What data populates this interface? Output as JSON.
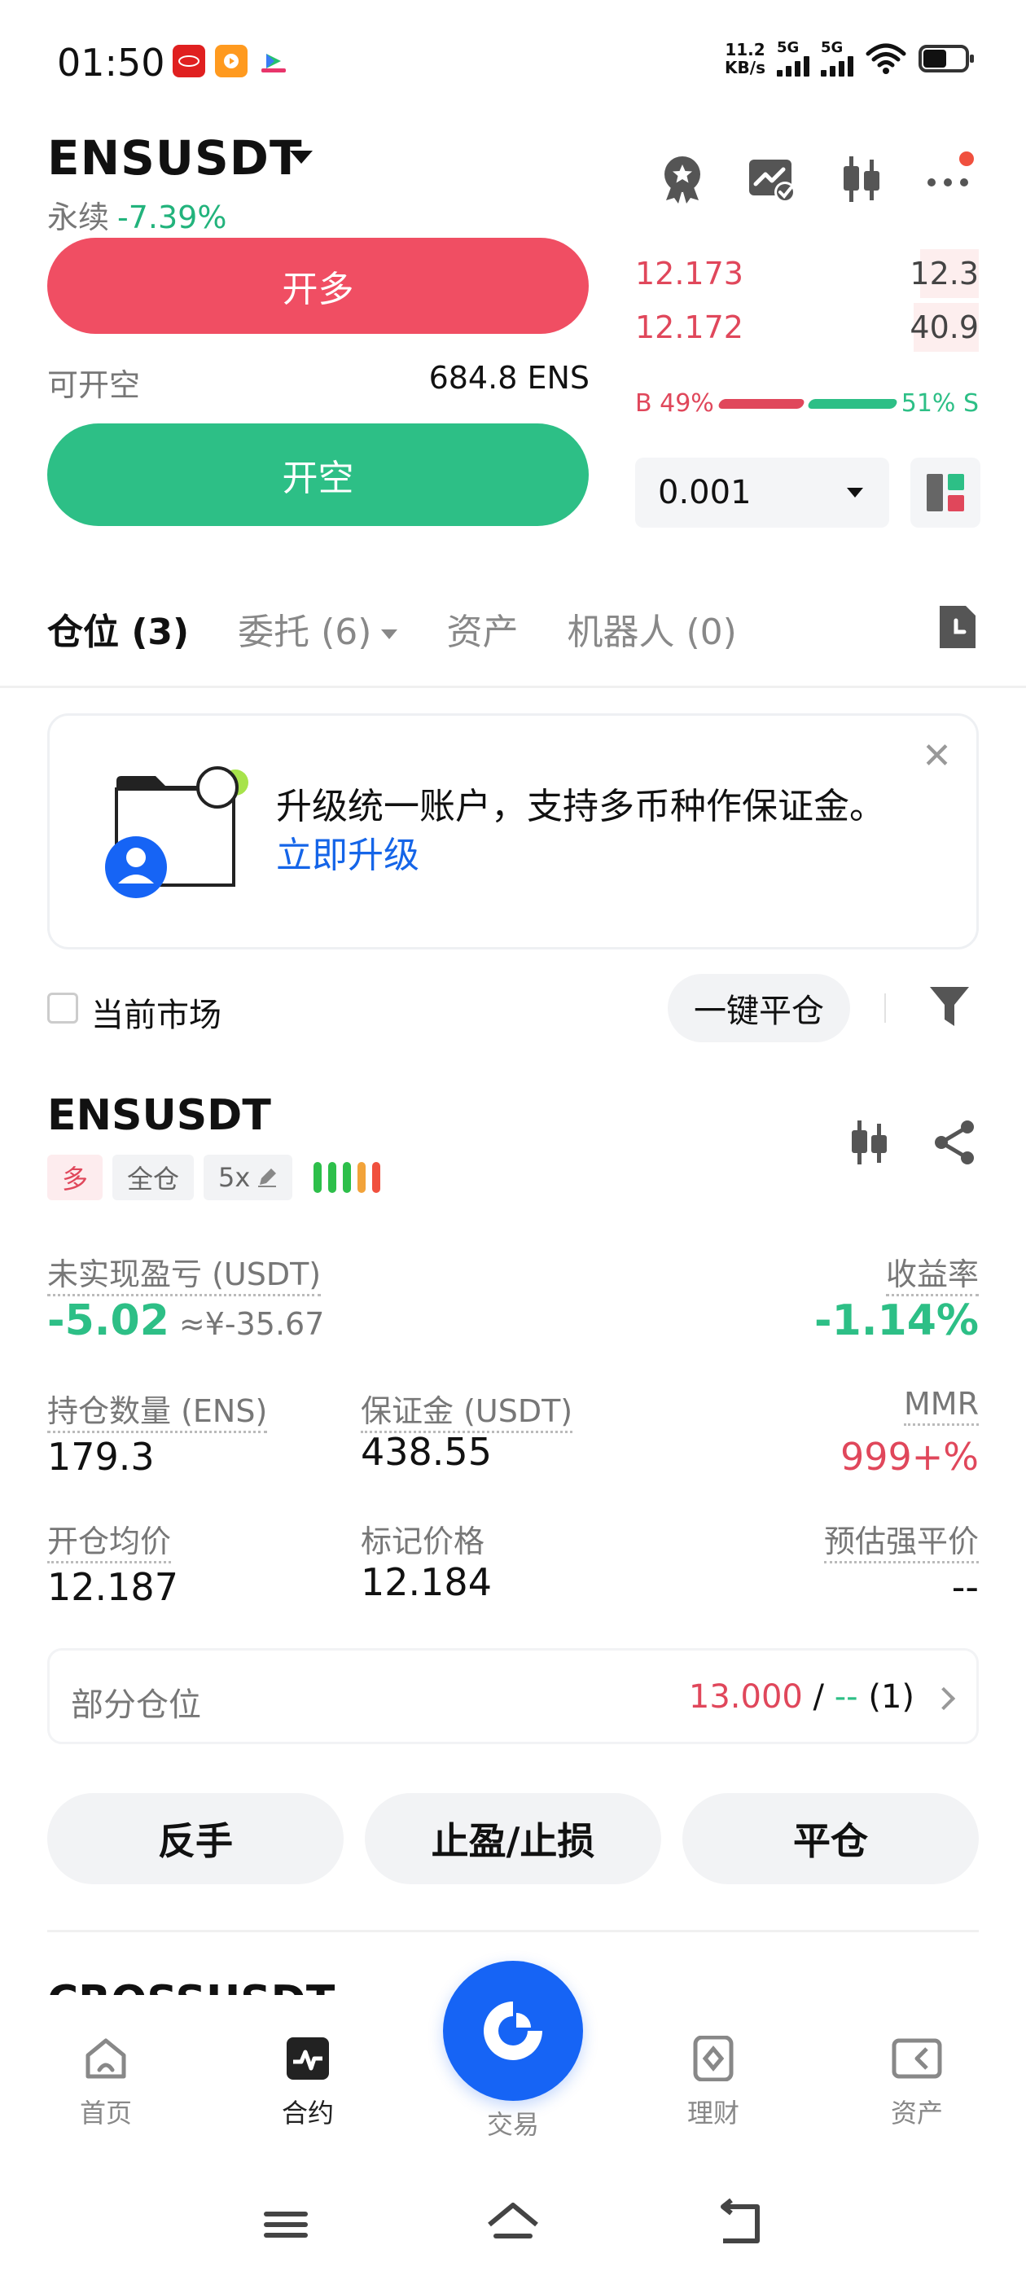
{
  "status_bar": {
    "time": "01:50",
    "net_speed": "11.2",
    "net_unit": "KB/s",
    "sig1": "5G",
    "sig2": "5G",
    "apps": [
      "byd-app-icon",
      "video-app-icon",
      "shop-app-icon"
    ]
  },
  "header": {
    "pair": "ENSUSDT",
    "market_type": "永续",
    "change": "-7.39%",
    "icons": [
      "award-icon",
      "chart-edit-icon",
      "candlestick-icon",
      "more-icon"
    ],
    "has_notification": true
  },
  "order_panel": {
    "long_label": "开多",
    "available_label": "可开空",
    "available_value": "684.8 ENS",
    "short_label": "开空"
  },
  "order_book": {
    "asks": [
      {
        "price": "12.173",
        "qty": "12.3",
        "depth": 0.17
      },
      {
        "price": "12.172",
        "qty": "40.9",
        "depth": 0.19
      }
    ],
    "buy_ratio": "B 49%",
    "sell_ratio": "51% S",
    "buy_pct": 49,
    "sell_pct": 51,
    "precision": "0.001"
  },
  "tabs": [
    {
      "label": "仓位 (3)",
      "active": true
    },
    {
      "label": "委托 (6)",
      "dropdown": true
    },
    {
      "label": "资产"
    },
    {
      "label": "机器人 (0)"
    }
  ],
  "promo": {
    "text": "升级统一账户，支持多币种作保证金。",
    "link": "立即升级"
  },
  "filter": {
    "current_market": "当前市场",
    "close_all": "一键平仓"
  },
  "position": {
    "symbol": "ENSUSDT",
    "side_tag": "多",
    "margin_mode": "全仓",
    "leverage": "5x",
    "adl_colors": [
      "#2dbf4a",
      "#2dbf4a",
      "#2dbf4a",
      "#f2a33a",
      "#f0503e"
    ],
    "unrealized_label": "未实现盈亏 (USDT)",
    "unrealized_value": "-5.02",
    "unrealized_cny": "≈¥-35.67",
    "roe_label": "收益率",
    "roe_value": "-1.14%",
    "size_label": "持仓数量 (ENS)",
    "size_value": "179.3",
    "margin_label": "保证金 (USDT)",
    "margin_value": "438.55",
    "mmr_label": "MMR",
    "mmr_value": "999+%",
    "entry_label": "开仓均价",
    "entry_value": "12.187",
    "mark_label": "标记价格",
    "mark_value": "12.184",
    "liq_label": "预估强平价",
    "liq_value": "--",
    "partial_label": "部分仓位",
    "partial_tp": "13.000",
    "partial_sep": " / ",
    "partial_sl": "--",
    "partial_count": " (1)"
  },
  "actions": {
    "reverse": "反手",
    "tpsl": "止盈/止损",
    "close": "平仓"
  },
  "next_symbol": "CROSSUSDT",
  "bottom_nav": {
    "home": "首页",
    "contract": "合约",
    "trade": "交易",
    "finance": "理财",
    "assets": "资产"
  }
}
